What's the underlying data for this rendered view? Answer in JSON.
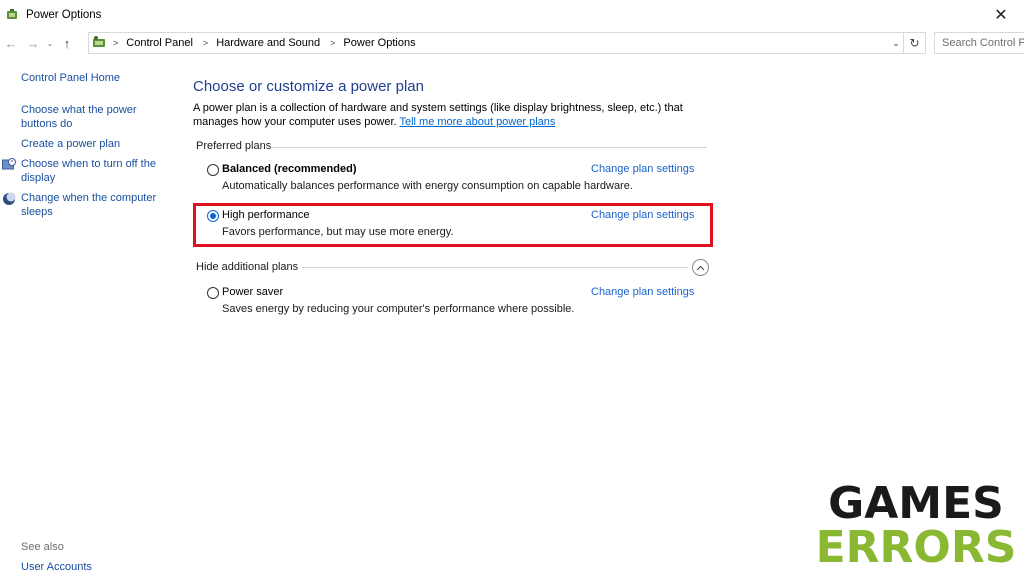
{
  "window": {
    "title": "Power Options",
    "close_glyph": "✕"
  },
  "address_bar": {
    "back_glyph": "←",
    "forward_glyph": "→",
    "dropdown_glyph": "⌄",
    "up_glyph": "↑",
    "separator_glyph": ">",
    "breadcrumbs": [
      "Control Panel",
      "Hardware and Sound",
      "Power Options"
    ],
    "history_glyph": "⌄",
    "refresh_glyph": "↻",
    "search_placeholder": "Search Control Panel"
  },
  "sidebar": {
    "home_link": "Control Panel Home",
    "links": [
      "Choose what the power buttons do",
      "Create a power plan",
      "Choose when to turn off the display",
      "Change when the computer sleeps"
    ],
    "see_also": "See also",
    "user_accounts": "User Accounts"
  },
  "main": {
    "title": "Choose or customize a power plan",
    "description": "A power plan is a collection of hardware and system settings (like display brightness, sleep, etc.) that manages how your computer uses power.",
    "learn_more_link": "Tell me more about power plans",
    "preferred_plans_label": "Preferred plans",
    "hide_plans_label": "Hide additional plans",
    "plans": [
      {
        "name": "Balanced (recommended)",
        "description": "Automatically balances performance with energy consumption on capable hardware.",
        "link": "Change plan settings",
        "selected": false
      },
      {
        "name": "High performance",
        "description": "Favors performance, but may use more energy.",
        "link": "Change plan settings",
        "selected": true
      },
      {
        "name": "Power saver",
        "description": "Saves energy by reducing your computer's performance where possible.",
        "link": "Change plan settings",
        "selected": false
      }
    ]
  },
  "watermark": {
    "line1": "GAMES",
    "line2": "ERRORS"
  },
  "colors": {
    "link_blue": "#1a63c9",
    "highlight_red": "#e0101e",
    "logo_dark": "#1a1a1a",
    "logo_green": "#8bb832"
  }
}
